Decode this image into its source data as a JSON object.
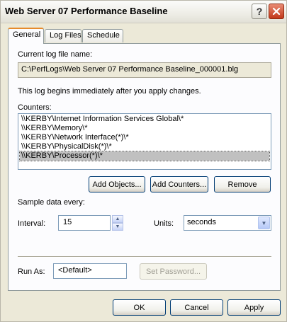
{
  "window": {
    "title": "Web Server 07 Performance Baseline",
    "help_glyph": "?",
    "close_glyph": "✕"
  },
  "tabs": [
    {
      "label": "General",
      "active": true
    },
    {
      "label": "Log Files",
      "active": false
    },
    {
      "label": "Schedule",
      "active": false
    }
  ],
  "general": {
    "current_log_label": "Current log file name:",
    "current_log_value": "C:\\PerfLogs\\Web Server 07 Performance Baseline_000001.blg",
    "info_text": "This log begins immediately after you apply changes.",
    "counters_label": "Counters:",
    "counters": [
      {
        "text": "\\\\KERBY\\Internet Information Services Global\\*",
        "selected": false
      },
      {
        "text": "\\\\KERBY\\Memory\\*",
        "selected": false
      },
      {
        "text": "\\\\KERBY\\Network Interface(*)\\*",
        "selected": false
      },
      {
        "text": "\\\\KERBY\\PhysicalDisk(*)\\*",
        "selected": false
      },
      {
        "text": "\\\\KERBY\\Processor(*)\\*",
        "selected": true
      }
    ],
    "buttons": {
      "add_objects": "Add Objects...",
      "add_counters": "Add Counters...",
      "remove": "Remove"
    },
    "sample_label": "Sample data every:",
    "interval_label": "Interval:",
    "interval_value": "15",
    "units_label": "Units:",
    "units_value": "seconds",
    "run_as_label": "Run As:",
    "run_as_value": "<Default>",
    "set_password": "Set Password..."
  },
  "footer": {
    "ok": "OK",
    "cancel": "Cancel",
    "apply": "Apply"
  },
  "colors": {
    "dialog_bg": "#ece9d8",
    "tab_highlight": "#e68b2c",
    "close_red": "#c2381a",
    "selection": "#c0c0c0"
  }
}
